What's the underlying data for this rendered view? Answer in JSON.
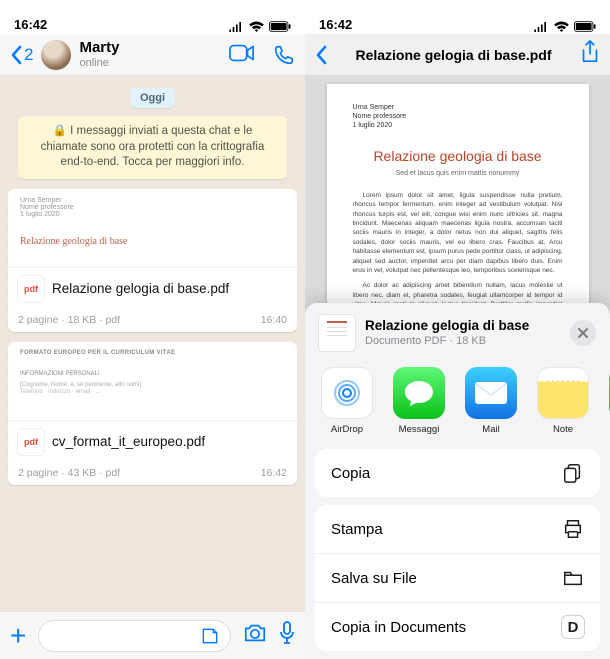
{
  "status": {
    "time": "16:42"
  },
  "chat": {
    "back_count": "2",
    "contact": "Marty",
    "presence": "online",
    "day_label": "Oggi",
    "e2e_notice": "I messaggi inviati a questa chat e le chiamate sono ora protetti con la crittografia end-to-end. Tocca per maggiori info.",
    "icons": {
      "video": "video-icon",
      "call": "phone-icon"
    },
    "messages": [
      {
        "preview_author": "Urna Semper",
        "preview_role": "Nome professore",
        "preview_date": "1 luglio 2020",
        "preview_title": "Relazione geologia di base",
        "file_label": "Relazione gelogia di base.pdf",
        "meta": "2 pagine · 18 KB · pdf",
        "time": "16:40"
      },
      {
        "preview_heading": "FORMATO EUROPEO PER IL CURRICULUM VITAE",
        "preview_section": "INFORMAZIONI PERSONALI",
        "preview_hint": "[Cognome, Nome; e, se pertinente, altri nomi]",
        "file_label": "cv_format_it_europeo.pdf",
        "meta": "2 pagine · 43 KB · pdf",
        "time": "16:42"
      }
    ],
    "compose": {
      "placeholder": ""
    }
  },
  "viewer": {
    "title": "Relazione gelogia di base.pdf",
    "page": {
      "author": "Urna Semper",
      "role": "Nome professore",
      "date": "1 luglio 2020",
      "heading": "Relazione geologia di base",
      "subheading": "Sed et lacus quis enim mattis nonummy",
      "p1": "Lorem ipsum dolor sit amet, ligula suspendisse nulla pretium, rhoncus tempor fermentum, enim integer ad vestibulum volutpat. Nisl rhoncus turpis est, vel elit, congue wisi enim nunc ultricies sit, magna tincidunt. Maecenas aliquam maecenas ligula nostra, accumsan taciti sociis mauris in integer, a dolor netus non dui aliquet, sagittis felis sodales, dolor sociis mauris, vel eu libero cras. Faucibus at. Arcu habitasse elementum est, ipsum purus pede porttitor class, ut adipiscing, aliquet sed auctor, imperdiet arcu per diam dapibus libero duis. Enim eros in vel, volutpat nec pellentesque leo, temporibus scelerisque nec.",
      "p2": "Ac dolor ac adipiscing amet bibendum nullam, lacus molestie ut libero nec, diam et, pharetra sodales, feugiat ullamcorper id tempor id vitae. Mauris pretium aliquet, lectus tincidunt. Porttitor mollis imperdiet libero senectus pulvinar. Etiam molestie mauris ligula laoreet, vehicula eleifend. Repellat orci erat et, sem cum, ultricies sollicitudin amet eleifend dolor."
    }
  },
  "share": {
    "title": "Relazione gelogia di base",
    "detail": "Documento PDF · 18 KB",
    "apps": [
      {
        "label": "AirDrop"
      },
      {
        "label": "Messaggi"
      },
      {
        "label": "Mail"
      },
      {
        "label": "Note"
      },
      {
        "label": ""
      }
    ],
    "actions": [
      {
        "label": "Copia",
        "icon": "copy"
      },
      {
        "label": "Stampa",
        "icon": "print"
      },
      {
        "label": "Salva su File",
        "icon": "folder"
      },
      {
        "label": "Copia in Documents",
        "icon": "documents-app"
      }
    ]
  }
}
